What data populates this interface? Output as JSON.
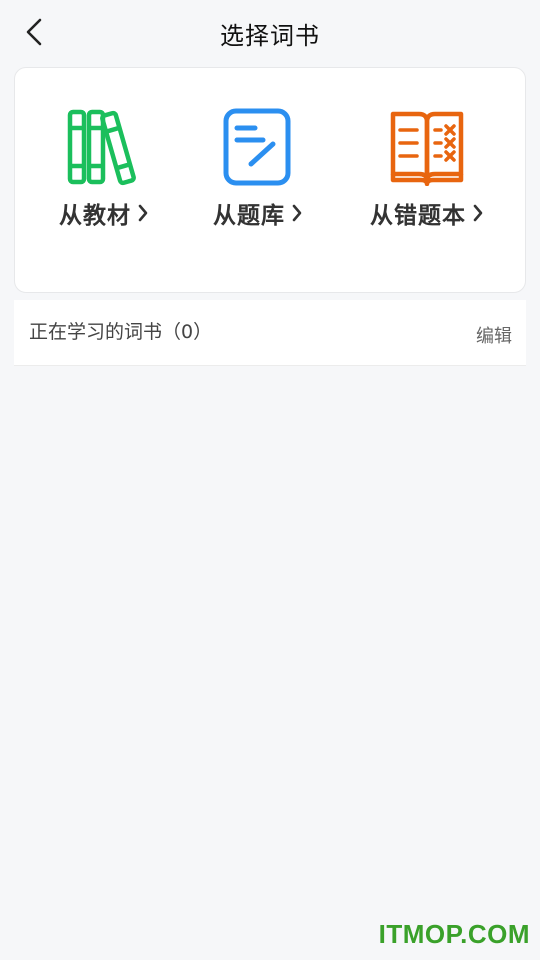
{
  "header": {
    "title": "选择词书",
    "back_icon": "chevron-left-icon"
  },
  "sources": [
    {
      "label": "从教材",
      "icon": "books-icon",
      "color": "#1bbf5c"
    },
    {
      "label": "从题库",
      "icon": "edit-note-icon",
      "color": "#2b8ff0"
    },
    {
      "label": "从错题本",
      "icon": "open-book-error-icon",
      "color": "#e8650f"
    }
  ],
  "studying": {
    "title": "正在学习的词书（0）",
    "edit_label": "编辑"
  },
  "watermark": "ITMOP.COM"
}
